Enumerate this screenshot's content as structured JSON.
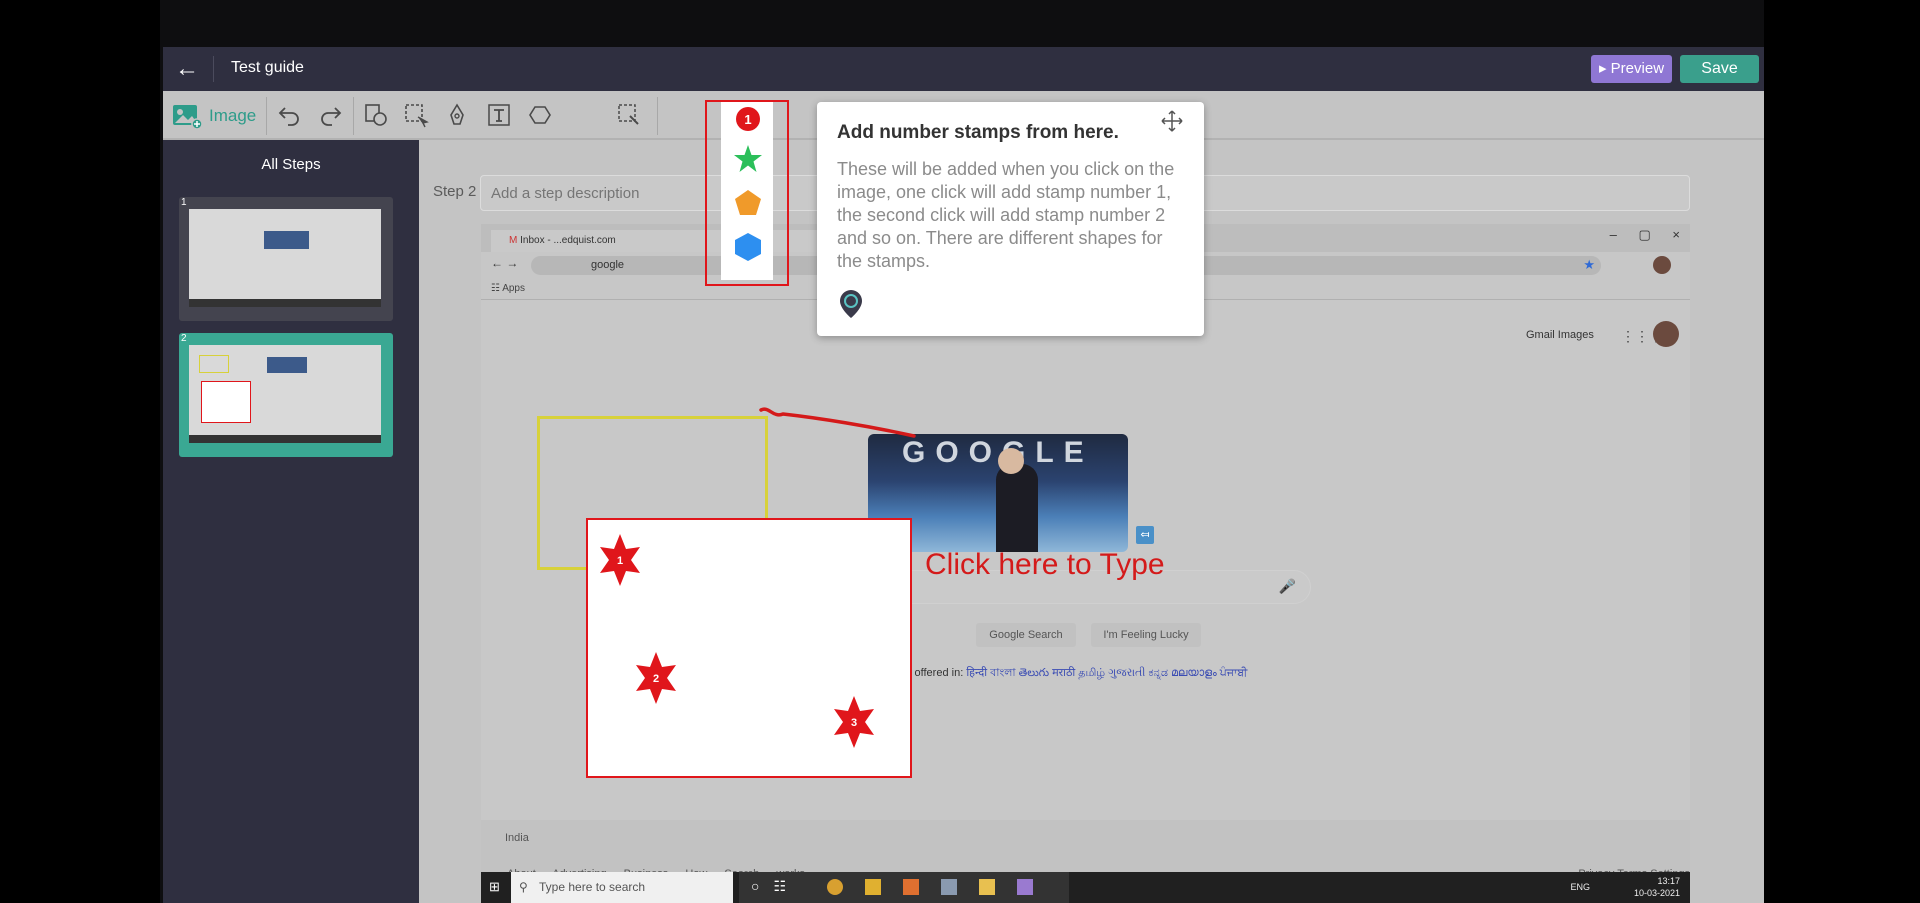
{
  "header": {
    "back_icon": "arrow-left-icon",
    "title": "Test guide",
    "preview_label": "Preview",
    "save_label": "Save",
    "preview_color": "#8f77d4",
    "save_color": "#3a9f8c"
  },
  "toolbar": {
    "image_label": "Image",
    "tools": [
      "undo-icon",
      "redo-icon",
      "shapes-icon",
      "crop-select-icon",
      "pen-icon",
      "text-icon",
      "stamp-icon",
      "blur-icon"
    ]
  },
  "sidebar": {
    "title": "All Steps",
    "steps": [
      {
        "number": "1",
        "selected": false
      },
      {
        "number": "2",
        "selected": true
      }
    ],
    "selected_color": "#3aa893"
  },
  "step": {
    "label": "Step 2",
    "placeholder": "Add a step description"
  },
  "stamp_menu": {
    "shapes": [
      "circle-stamp-icon",
      "star-stamp-icon",
      "pentagon-stamp-icon",
      "hexagon-stamp-icon"
    ],
    "badge": "1"
  },
  "tooltip": {
    "title": "Add number stamps from here.",
    "body": "These will be added when you click on the image, one click will add stamp number 1, the second click will add stamp number 2 and so on. There are different shapes for the stamps."
  },
  "canvas": {
    "type_prompt": "Click here to Type",
    "stamps": [
      "1",
      "2",
      "3"
    ]
  },
  "screenshot": {
    "tab_label": "Inbox - ...edquist.com",
    "bookmarks_label": "Apps",
    "url_text": "google",
    "doodle_text": "GOOGLE",
    "top_links": "Gmail   Images",
    "search_btn": "Google Search",
    "lucky_btn": "I'm Feeling Lucky",
    "offered_prefix": "Google offered in:",
    "offered_langs": "हिन्दी  বাংলা  తెలుగు  मराठी  தமிழ்  ગુજરાતી  ಕನ್ನಡ  മലയാളം  ਪੰਜਾਬੀ",
    "country": "India",
    "footer_left": "About Advertising Business How Search works",
    "footer_right": "Privacy   Terms   Settings",
    "taskbar_search": "Type here to search",
    "tray_lang": "ENG",
    "tray_time": "13:17",
    "tray_date": "10-03-2021"
  }
}
